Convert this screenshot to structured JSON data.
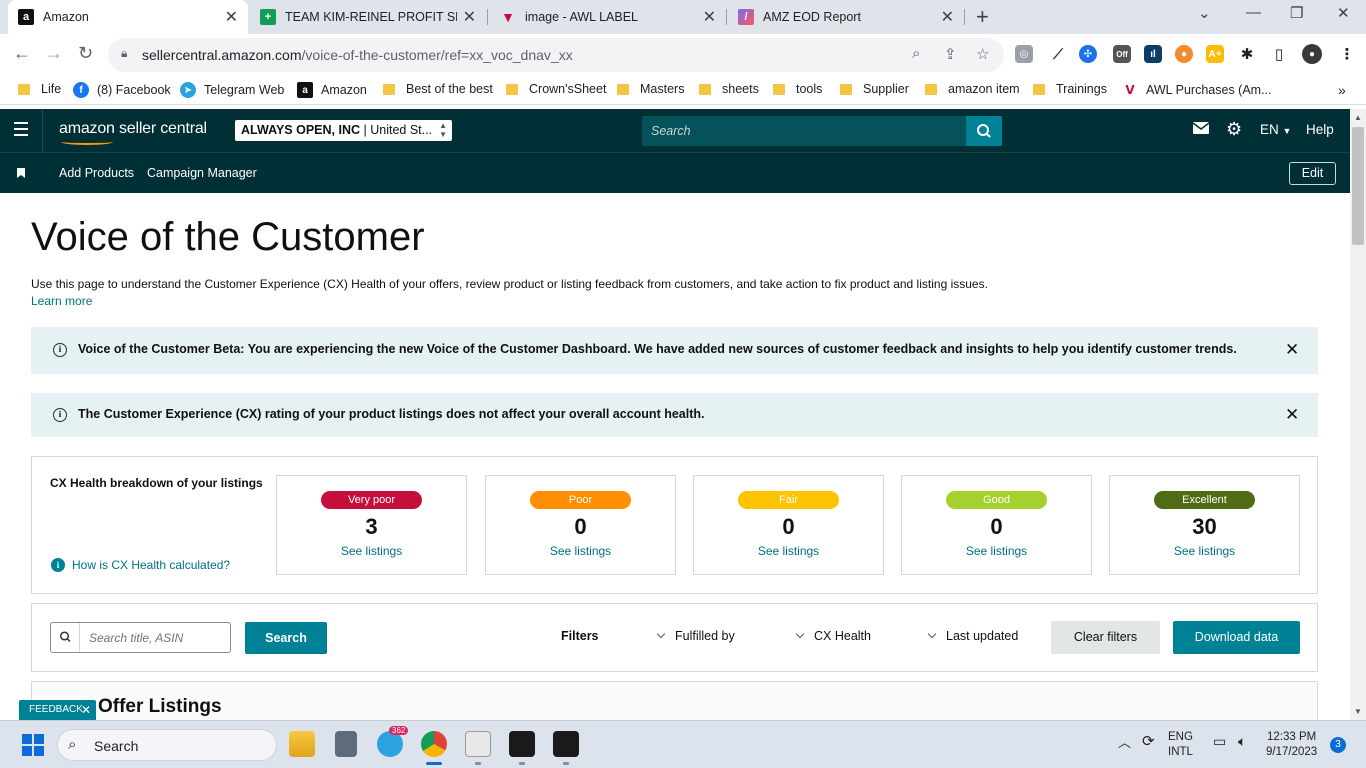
{
  "browser": {
    "tabs": [
      {
        "title": "Amazon",
        "active": true
      },
      {
        "title": "TEAM KIM-REINEL PROFIT SHEET",
        "active": false
      },
      {
        "title": "image - AWL LABEL",
        "active": false
      },
      {
        "title": "AMZ EOD Report",
        "active": false
      }
    ],
    "url_domain": "sellercentral.amazon.com",
    "url_path": "/voice-of-the-customer/ref=xx_voc_dnav_xx",
    "bookmarks": [
      {
        "label": "Life",
        "type": "folder"
      },
      {
        "label": "(8) Facebook",
        "type": "site"
      },
      {
        "label": "Telegram Web",
        "type": "site"
      },
      {
        "label": "Amazon",
        "type": "site"
      },
      {
        "label": "Best of the best",
        "type": "folder"
      },
      {
        "label": "Crown'sSheet",
        "type": "folder"
      },
      {
        "label": "Masters",
        "type": "folder"
      },
      {
        "label": "sheets",
        "type": "folder"
      },
      {
        "label": "tools",
        "type": "folder"
      },
      {
        "label": "Supplier",
        "type": "folder"
      },
      {
        "label": "amazon item",
        "type": "folder"
      },
      {
        "label": "Trainings",
        "type": "folder"
      },
      {
        "label": "AWL Purchases (Am...",
        "type": "site"
      }
    ],
    "extension_badge": "Off"
  },
  "header": {
    "logo": "amazon seller central",
    "account_name": "ALWAYS OPEN, INC",
    "account_market": "United St...",
    "search_placeholder": "Search",
    "language": "EN",
    "help": "Help"
  },
  "nav": {
    "links": [
      "Add Products",
      "Campaign Manager"
    ],
    "edit": "Edit"
  },
  "page": {
    "title": "Voice of the Customer",
    "description": "Use this page to understand the Customer Experience (CX) Health of your offers, review product or listing feedback from customers, and take action to fix product and listing issues.",
    "learn_more": "Learn more",
    "alerts": [
      "Voice of the Customer Beta: You are experiencing the new Voice of the Customer Dashboard. We have added new sources of customer feedback and insights to help you identify customer trends.",
      "The Customer Experience (CX) rating of your product listings does not affect your overall account health."
    ],
    "breakdown": {
      "title": "CX Health breakdown of your listings",
      "help_link": "How is CX Health calculated?",
      "cards": [
        {
          "label": "Very poor",
          "count": "3",
          "link": "See listings",
          "color": "#c40f3c",
          "text_color": "#ffffff"
        },
        {
          "label": "Poor",
          "count": "0",
          "link": "See listings",
          "color": "#ff8f00",
          "text_color": "#ffffff"
        },
        {
          "label": "Fair",
          "count": "0",
          "link": "See listings",
          "color": "#ffc400",
          "text_color": "#ffffff"
        },
        {
          "label": "Good",
          "count": "0",
          "link": "See listings",
          "color": "#a4d12e",
          "text_color": "#ffffff"
        },
        {
          "label": "Excellent",
          "count": "30",
          "link": "See listings",
          "color": "#4f6c14",
          "text_color": "#ffffff"
        }
      ]
    },
    "filters": {
      "search_placeholder": "Search title, ASIN",
      "search_button": "Search",
      "label": "Filters",
      "options": [
        "Fulfilled by",
        "CX Health",
        "Last updated"
      ],
      "clear": "Clear filters",
      "download": "Download data"
    },
    "listings_title": "Offer Listings",
    "feedback": "FEEDBACK"
  },
  "taskbar": {
    "search": "Search",
    "telegram_badge": "362",
    "lang_top": "ENG",
    "lang_bottom": "INTL",
    "time": "12:33 PM",
    "date": "9/17/2023",
    "notifications": "3"
  }
}
